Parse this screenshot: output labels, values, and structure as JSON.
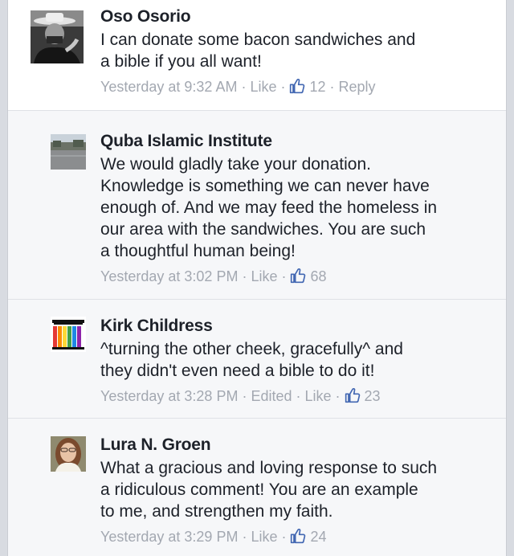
{
  "comments": [
    {
      "name": "Oso Osorio",
      "text": "I can donate some bacon sandwiches and\na bible if you all want!",
      "time": "Yesterday at 9:32 AM",
      "like_label": "Like",
      "likes": "12",
      "reply_label": "Reply"
    },
    {
      "name": "Quba Islamic Institute",
      "text": "We would gladly take your donation.\nKnowledge is something we can never have\nenough of. And we may feed the homeless in\nour area with the sandwiches. You are such\na thoughtful human being!",
      "time": "Yesterday at 3:02 PM",
      "like_label": "Like",
      "likes": "68"
    },
    {
      "name": "Kirk Childress",
      "text": "^turning the other cheek, gracefully^ and\nthey didn't even need a bible to do it!",
      "time": "Yesterday at 3:28 PM",
      "edited_label": "Edited",
      "like_label": "Like",
      "likes": "23"
    },
    {
      "name": "Lura N. Groen",
      "text": "What a gracious and loving response to such\na ridiculous comment!  You are an example\nto me, and strengthen my faith.",
      "time": "Yesterday at 3:29 PM",
      "like_label": "Like",
      "likes": "24"
    }
  ],
  "separator": "·",
  "colors": {
    "name_text": "#1d2129",
    "meta_text": "#a3a8b1",
    "thumb_icon": "#4267b2",
    "reply_background": "#f6f7f9"
  }
}
